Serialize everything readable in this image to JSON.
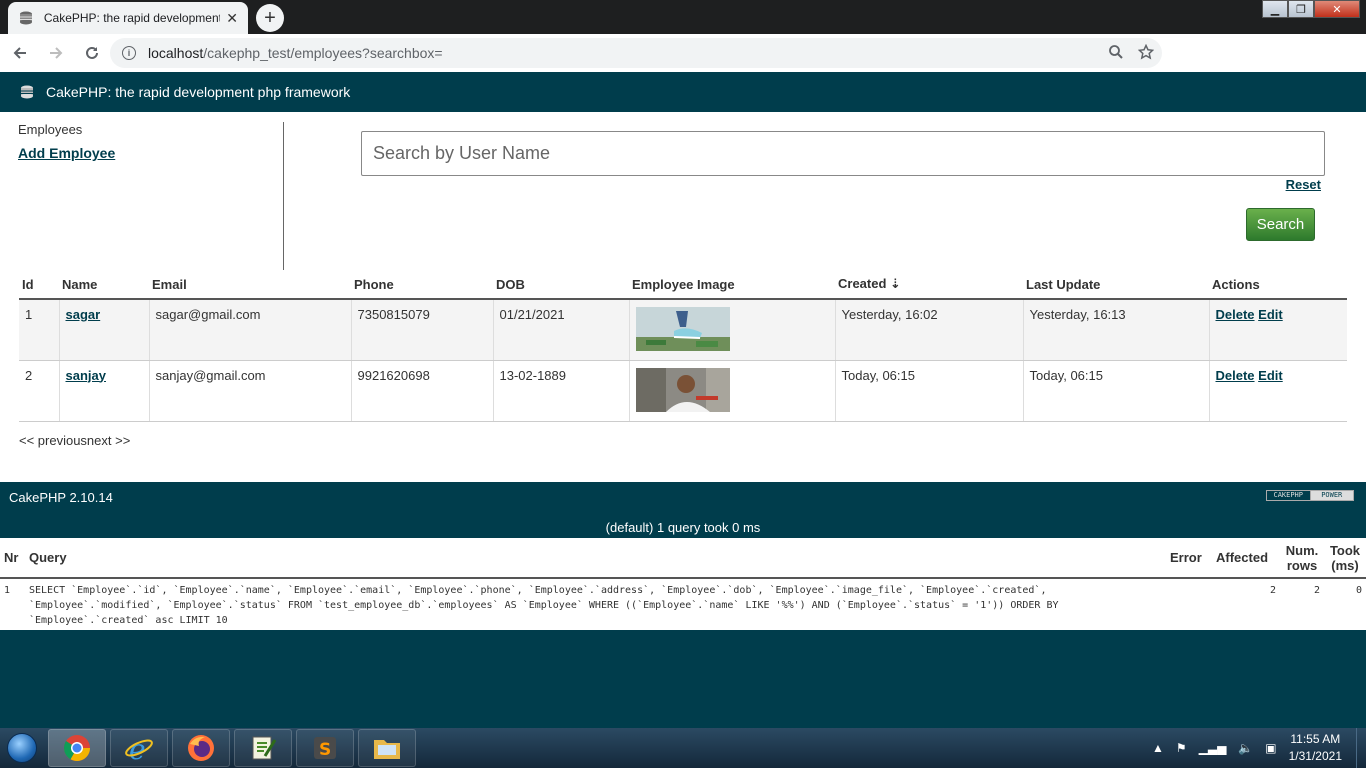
{
  "browser": {
    "tab_title": "CakePHP: the rapid development php framework",
    "tab_close": "✕",
    "new_tab": "+",
    "url_host": "localhost",
    "url_path": "/cakephp_test/employees?searchbox=",
    "win_min": "▁",
    "win_max": "❐",
    "win_close": "✕"
  },
  "header": {
    "title": "CakePHP: the rapid development php framework"
  },
  "actions": {
    "heading": "Employees",
    "add_link": "Add Employee"
  },
  "search": {
    "placeholder": "Search by User Name",
    "reset_label": "Reset",
    "search_label": "Search"
  },
  "table": {
    "columns": [
      "Id",
      "Name",
      "Email",
      "Phone",
      "DOB",
      "Employee Image",
      "Created ⇣",
      "Last Update",
      "Actions"
    ],
    "rows": [
      {
        "id": "1",
        "name": "sagar",
        "email": "sagar@gmail.com",
        "phone": "7350815079",
        "dob": "01/21/2021",
        "created": "Yesterday, 16:02",
        "updated": "Yesterday, 16:13",
        "delete": "Delete",
        "edit": "Edit"
      },
      {
        "id": "2",
        "name": "sanjay",
        "email": "sanjay@gmail.com",
        "phone": "9921620698",
        "dob": "13-02-1889",
        "created": "Today, 06:15",
        "updated": "Today, 06:15",
        "delete": "Delete",
        "edit": "Edit"
      }
    ]
  },
  "pager": {
    "text": "<< previousnext >>"
  },
  "footer": {
    "version": "CakePHP 2.10.14",
    "powered_left": "CAKEPHP",
    "powered_right": "POWER"
  },
  "sql": {
    "caption": "(default) 1 query took 0 ms",
    "headers": {
      "nr": "Nr",
      "query": "Query",
      "error": "Error",
      "affected": "Affected",
      "num_rows": "Num. rows",
      "took": "Took (ms)"
    },
    "rows": [
      {
        "nr": "1",
        "query": "SELECT `Employee`.`id`, `Employee`.`name`, `Employee`.`email`, `Employee`.`phone`, `Employee`.`address`, `Employee`.`dob`, `Employee`.`image_file`, `Employee`.`created`, `Employee`.`modified`, `Employee`.`status` FROM `test_employee_db`.`employees` AS `Employee` WHERE ((`Employee`.`name` LIKE '%%') AND (`Employee`.`status` = '1')) ORDER BY `Employee`.`created` asc LIMIT 10",
        "error": "",
        "affected": "2",
        "num_rows": "2",
        "took": "0"
      }
    ]
  },
  "taskbar": {
    "time": "11:55 AM",
    "date": "1/31/2021"
  }
}
